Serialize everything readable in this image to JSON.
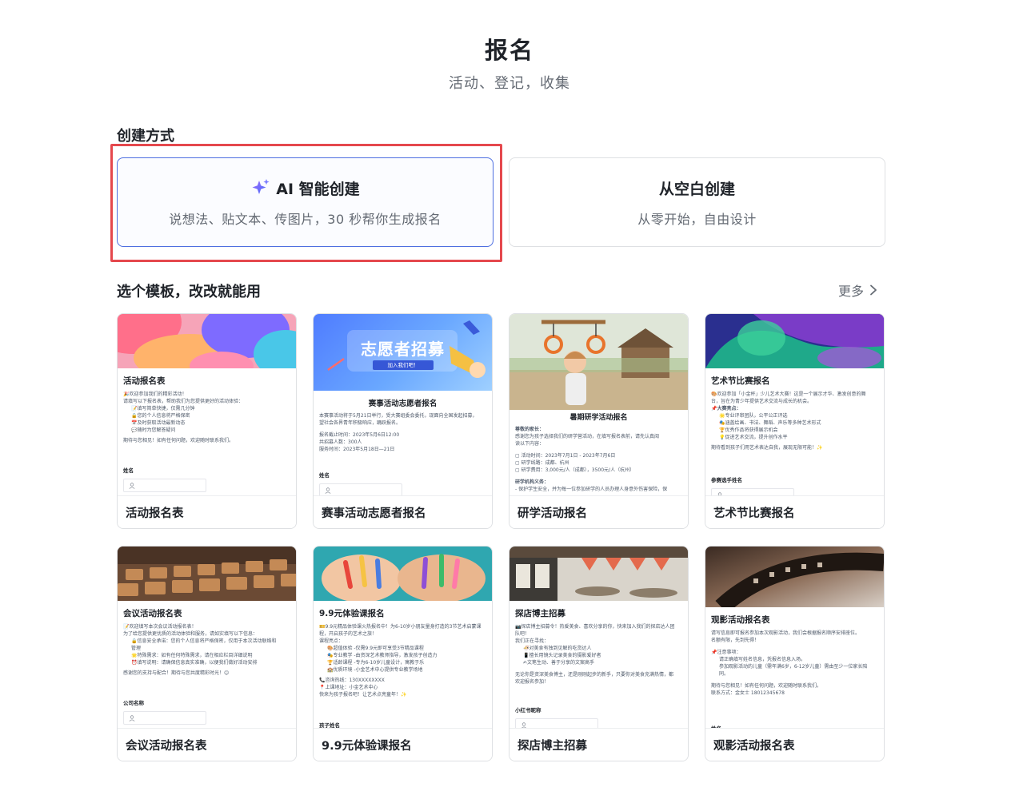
{
  "header": {
    "title": "报名",
    "subtitle": "活动、登记，收集"
  },
  "create": {
    "section_title": "创建方式",
    "ai": {
      "icon": "sparkle-icon",
      "title": "AI 智能创建",
      "desc": "说想法、贴文本、传图片，30 秒帮你生成报名"
    },
    "blank": {
      "title": "从空白创建",
      "desc": "从零开始，自由设计"
    }
  },
  "templates": {
    "section_title": "选个模板，改改就能用",
    "more_label": "更多",
    "items": [
      {
        "name": "活动报名表",
        "form_title": "活动报名表",
        "lines": [
          "🎉欢迎参加我们的精彩活动！",
          "请填写以下报名表，帮助我们为您提供更好的活动体验：",
          "📝填写简单快捷，仅需几分钟",
          "🔒您的个人信息将严格保密",
          "📅及时获取活动最新动态",
          "💬随时为您解答疑问",
          "期待与您相见！如有任何问题，欢迎随时联系我们。"
        ],
        "field_label": "姓名"
      },
      {
        "name": "赛事活动志愿者报名",
        "banner_title": "志愿者招募",
        "banner_sub": "加入我们吧！",
        "form_title": "赛事活动志愿者报名",
        "lines": [
          "本赛事活动将于5月21日举行，受大赛组委会委托，现面向全国发起招募，",
          "望社会各界青年积极响应，踊跃报名。",
          "报名截止时间：2023年5月6日12:00",
          "共招募人数：300人",
          "服务时间：2023年5月18日—21日"
        ],
        "field_label": "姓名"
      },
      {
        "name": "研学活动报名",
        "form_title": "暑期研学活动报名",
        "lines": [
          "尊敬的家长：",
          "感谢您为孩子选择我们的研学营活动，在填写报名表前，请先认真阅",
          "读以下内容：",
          "▢ 活动时间：2023年7月1日 - 2023年7月6日",
          "▢ 研学线路：成都、杭州",
          "▢ 研学费用：3,000元/人（成都），3500元/人（杭州）",
          "研学机构义务：",
          "- 保护学生安全，并为每一位参加研学的人员办理人身意外伤害保险，保"
        ]
      },
      {
        "name": "艺术节比赛报名",
        "form_title": "艺术节比赛报名",
        "lines": [
          "🎨欢迎参加「小金杯」少儿艺术大赛！这是一个展示才华、激发创意的舞",
          "台，旨在为青少年提供艺术交流与成长的机会。",
          "📌大赛亮点：",
          "🌟专业评审团队，公平公正评选",
          "🎭涵盖绘画、书法、舞蹈、声乐等多种艺术形式",
          "🏆优秀作品将获得展示机会",
          "💡促进艺术交流，提升创作水平",
          "期待看到孩子们用艺术表达自我，展现无限可能！✨"
        ],
        "field_label": "参赛选手姓名"
      },
      {
        "name": "会议活动报名表",
        "form_title": "会议活动报名表",
        "lines": [
          "📝欢迎填写本次会议活动报名表！",
          "为了给您提供更优质的活动体验和服务，请如实填写以下信息：",
          "🔒信息安全承诺：您的个人信息将严格保密，仅用于本次活动联络和",
          "管理",
          "🌟特殊需求：如有任何特殊需求，请在相应栏目详细说明",
          "⏰填写说明：请确保信息真实准确，以便我们做好活动安排",
          "感谢您的支持与配合！期待与您共度精彩时光！😊"
        ],
        "field_label": "公司名称"
      },
      {
        "name": "9.9元体验课报名",
        "form_title": "9.9元体验课报名",
        "lines": [
          "🎫9.9元精品体验课火热报名中！为6-10岁小朋友量身打造的3节艺术启蒙课",
          "程，开启孩子的艺术之旅！",
          "课程亮点：",
          "🎨超值体验 -仅需9.9元即可享受3节精品课程",
          "🎭专业教学 -由资深艺术教师指导，激发孩子创造力",
          "🏆适龄课程 -专为6-10岁儿童设计，寓教于乐",
          "🏫优质环境 -小金艺术中心提供专业教学场地",
          "📞咨询热线：130XXXXXXXX",
          "📍上课地址：小金艺术中心",
          "快来为孩子报名吧！让艺术点亮童年！✨"
        ],
        "field_label": "孩子姓名"
      },
      {
        "name": "探店博主招募",
        "form_title": "探店博主招募",
        "lines": [
          "📷探店博主招募令！热爱美食、喜欢分享的你，快来加入我们的探店达人团",
          "队吧！",
          "我们正在寻找：",
          "🍜对美食有独到见解的吃货达人",
          "📱擅长用镜头记录美食的摄影爱好者",
          "✍文笔生动、善于分享的文案高手",
          "无论你是资深美食博主，还是刚刚起步的新手，只要你对美食充满热情，都",
          "欢迎报名参加！"
        ],
        "field_label": "小红书昵称"
      },
      {
        "name": "观影活动报名表",
        "form_title": "观影活动报名表",
        "lines": [
          "请写信息即可报名参加本次观影活动，我们会根据报名顺序安排座位。",
          "名额有限，先到先得！",
          "📌注意事项：",
          "请正确填写姓名信息，凭报名信息入场。",
          "参加观影活动的儿童（需年满6岁，6-12岁儿童）需由至少一位家长陪",
          "同。",
          "期待与您相见！如有任何问题，欢迎随时联系我们。",
          "联系方式：金女士 18012345678"
        ],
        "field_label": "姓名"
      }
    ]
  }
}
